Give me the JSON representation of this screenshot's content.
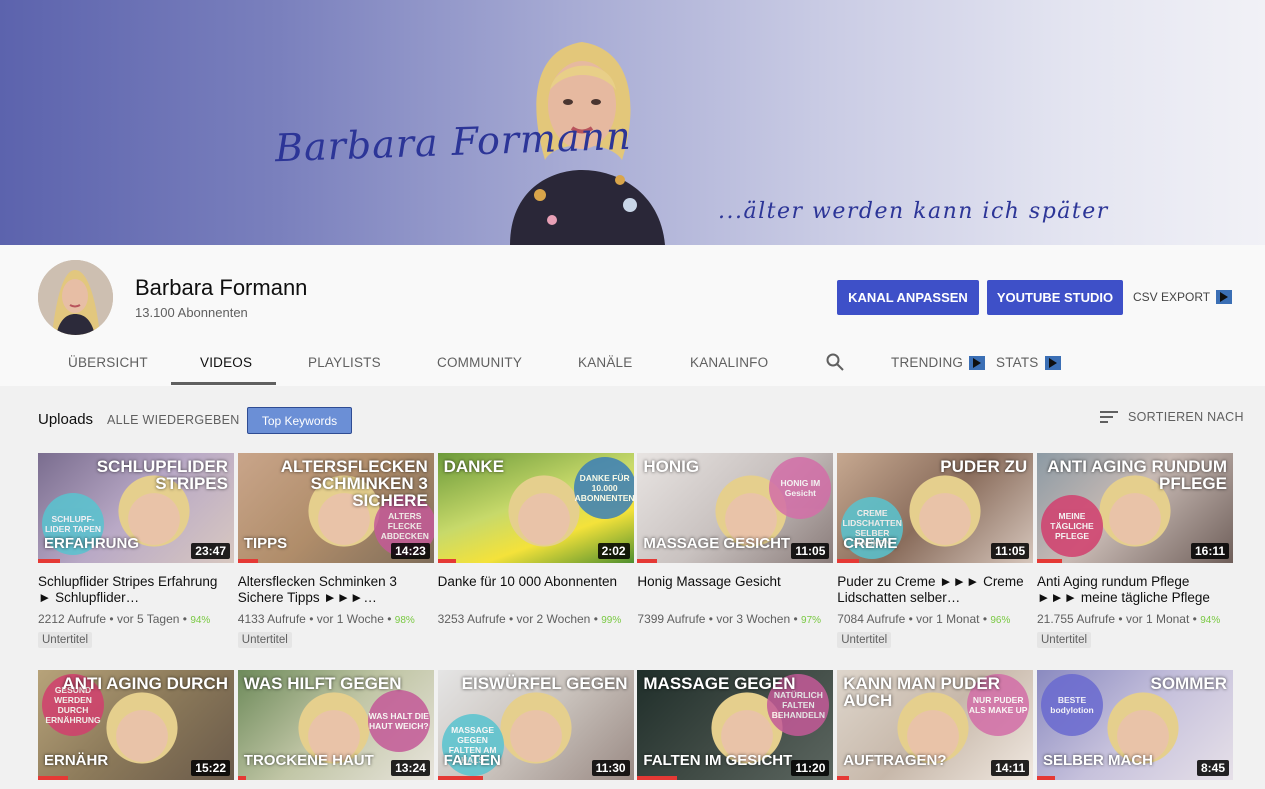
{
  "banner": {
    "name": "Barbara Formann",
    "slogan": "...älter werden kann ich später"
  },
  "channel": {
    "name": "Barbara Formann",
    "subscribers": "13.100 Abonnenten",
    "buttons": {
      "customize": "KANAL ANPASSEN",
      "studio": "YOUTUBE STUDIO",
      "csv": "CSV EXPORT"
    }
  },
  "tabs": {
    "overview": "ÜBERSICHT",
    "videos": "VIDEOS",
    "playlists": "PLAYLISTS",
    "community": "COMMUNITY",
    "channels": "KANÄLE",
    "about": "KANALINFO",
    "trending": "TRENDING",
    "stats": "STATS"
  },
  "toolbar": {
    "uploads": "Uploads",
    "play_all": "ALLE WIEDERGEBEN",
    "keywords": "Top Keywords",
    "sort": "SORTIEREN NACH"
  },
  "colors": {
    "accent": "#3e50c8",
    "progress": "#e53935",
    "percent": "#7ac943"
  },
  "videos": [
    {
      "duration": "23:47",
      "title": "Schlupflider Stripes Erfahrung ► Schlupflider…",
      "views": "2212 Aufrufe",
      "age": "vor 5 Tagen",
      "percent": "94%",
      "badge": "Untertitel",
      "overlay": "SCHLUPFLIDER STRIPES",
      "overlay2": "Erfahrung",
      "bubble": "SCHLUPF-LIDER TAPEN"
    },
    {
      "duration": "14:23",
      "title": "Altersflecken Schminken 3 Sichere Tipps ►►►…",
      "views": "4133 Aufrufe",
      "age": "vor 1 Woche",
      "percent": "98%",
      "badge": "Untertitel",
      "overlay": "ALTERSFLECKEN SCHMINKEN 3 SICHERE",
      "overlay2": "Tipps",
      "bubble": "ALTERS FLECKE ABDECKEN"
    },
    {
      "duration": "2:02",
      "title": "Danke für 10 000 Abonnenten",
      "views": "3253 Aufrufe",
      "age": "vor 2 Wochen",
      "percent": "99%",
      "badge": "",
      "overlay": "DANKE",
      "overlay2": "",
      "bubble": "DANKE FÜR 10.000 ABONNENTEN"
    },
    {
      "duration": "11:05",
      "title": "Honig Massage Gesicht",
      "views": "7399 Aufrufe",
      "age": "vor 3 Wochen",
      "percent": "97%",
      "badge": "",
      "overlay": "HONIG",
      "overlay2": "Massage GESICHT",
      "bubble": "HONIG IM Gesicht"
    },
    {
      "duration": "11:05",
      "title": "Puder zu Creme ►►► Creme Lidschatten selber…",
      "views": "7084 Aufrufe",
      "age": "vor 1 Monat",
      "percent": "96%",
      "badge": "Untertitel",
      "overlay": "PUDER ZU",
      "overlay2": "CREME",
      "bubble": "CREME LIDSCHATTEN SELBER MACHEN"
    },
    {
      "duration": "16:11",
      "title": "Anti Aging rundum Pflege ►►► meine tägliche Pflege",
      "views": "21.755 Aufrufe",
      "age": "vor 1 Monat",
      "percent": "94%",
      "badge": "Untertitel",
      "overlay": "ANTI AGING rundum PFLEGE",
      "overlay2": "",
      "bubble": "MEINE TÄGLICHE PFLEGE"
    },
    {
      "duration": "15:22",
      "title": "",
      "views": "",
      "age": "",
      "percent": "",
      "badge": "",
      "overlay": "ANTI AGING DURCH",
      "overlay2": "ERNÄHR",
      "bubble": "GESUND WERDEN DURCH ERNÄHRUNG"
    },
    {
      "duration": "13:24",
      "title": "",
      "views": "",
      "age": "",
      "percent": "",
      "badge": "",
      "overlay": "WAS HILFT GEGEN",
      "overlay2": "trockene HAUT",
      "bubble": "WAS HALT DIE HAUT WEICH?"
    },
    {
      "duration": "11:30",
      "title": "",
      "views": "",
      "age": "",
      "percent": "",
      "badge": "",
      "overlay": "EISWÜRFEL GEGEN",
      "overlay2": "FALTEN",
      "bubble": "MASSAGE GEGEN FALTEN AM HALS"
    },
    {
      "duration": "11:20",
      "title": "",
      "views": "",
      "age": "",
      "percent": "",
      "badge": "",
      "overlay": "MASSAGE GEGEN",
      "overlay2": "FALTEN IM GESICHT",
      "bubble": "NATÜRLICH FALTEN BEHANDELN"
    },
    {
      "duration": "14:11",
      "title": "",
      "views": "",
      "age": "",
      "percent": "",
      "badge": "",
      "overlay": "KANN MAN PUDER AUCH",
      "overlay2": "AUFTRAGEN?",
      "bubble": "NUR PUDER ALS MAKE UP"
    },
    {
      "duration": "8:45",
      "title": "",
      "views": "",
      "age": "",
      "percent": "",
      "badge": "",
      "overlay": "SOMMER",
      "overlay2": "SELBER MACH",
      "bubble": "BESTE bodylotion"
    }
  ]
}
